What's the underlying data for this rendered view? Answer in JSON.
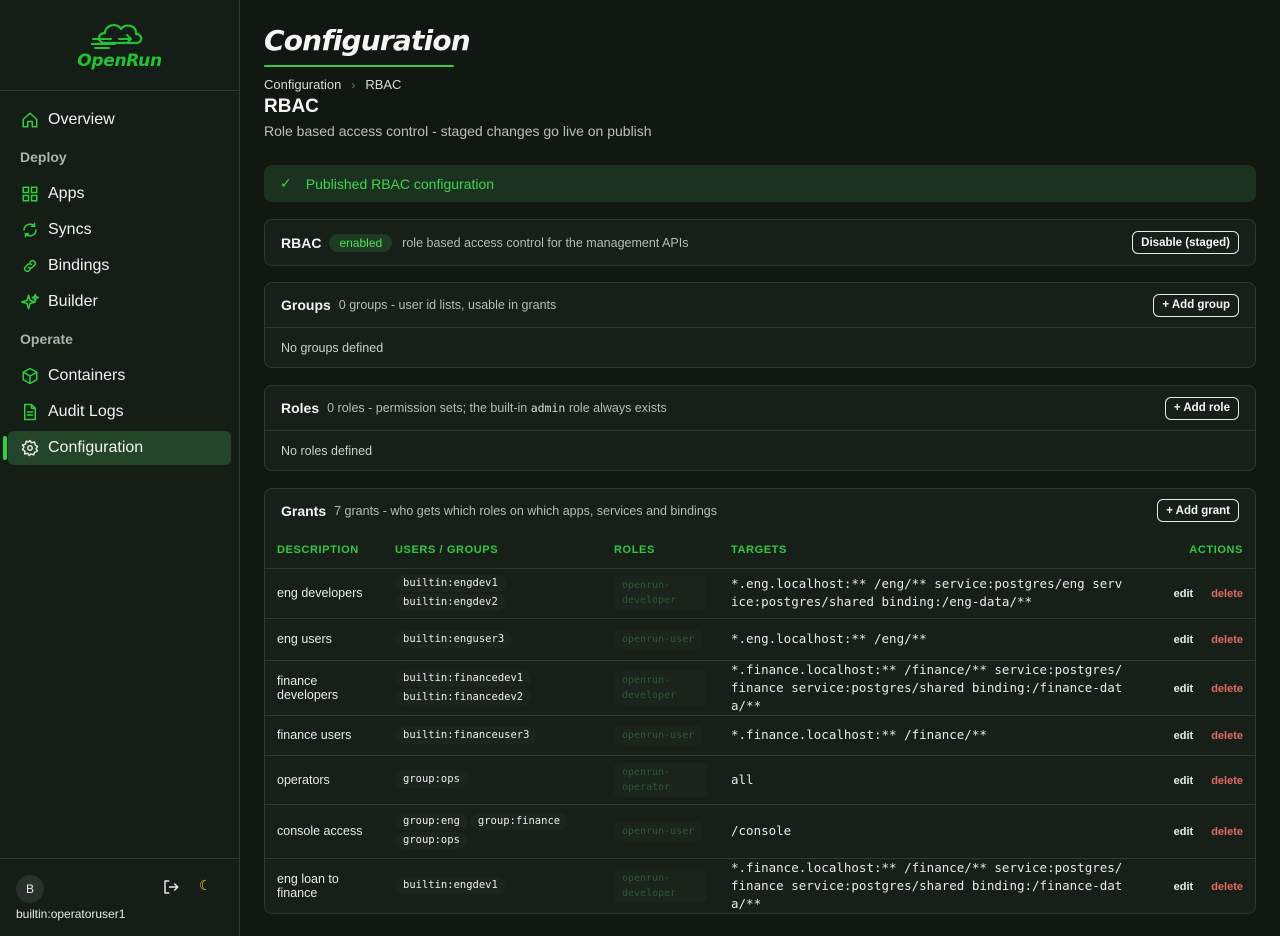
{
  "app": {
    "logo_text": "OpenRun"
  },
  "sidebar": {
    "items": [
      {
        "label": "Overview",
        "icon": "home-icon"
      },
      {
        "section": "Deploy"
      },
      {
        "label": "Apps",
        "icon": "grid-icon"
      },
      {
        "label": "Syncs",
        "icon": "refresh-icon"
      },
      {
        "label": "Bindings",
        "icon": "link-icon"
      },
      {
        "label": "Builder",
        "icon": "sparkles-icon"
      },
      {
        "section": "Operate"
      },
      {
        "label": "Containers",
        "icon": "box-icon"
      },
      {
        "label": "Audit Logs",
        "icon": "document-icon"
      },
      {
        "label": "Configuration",
        "icon": "gear-icon",
        "active": true
      }
    ],
    "footer": {
      "avatar_letter": "B",
      "user": "builtin:operatoruser1",
      "theme_icon": "☾"
    }
  },
  "page": {
    "title": "Configuration",
    "breadcrumb": [
      "Configuration",
      "RBAC"
    ],
    "subtitle": "RBAC",
    "description": "Role based access control - staged changes go live on publish"
  },
  "alert": {
    "icon": "✓",
    "text": "Published RBAC configuration"
  },
  "rbac_card": {
    "title": "RBAC",
    "badge": "enabled",
    "desc": "role based access control for the management APIs",
    "button": "Disable (staged)"
  },
  "groups_card": {
    "title": "Groups",
    "meta": "0 groups - user id lists, usable in grants",
    "button": "+ Add group",
    "empty": "No groups defined"
  },
  "roles_card": {
    "title": "Roles",
    "meta_before": "0 roles - permission sets; the built-in",
    "meta_code": "admin",
    "meta_after": "role always exists",
    "button": "+ Add role",
    "empty": "No roles defined"
  },
  "grants_card": {
    "title": "Grants",
    "meta": "7 grants - who gets which roles on which apps, services and bindings",
    "button": "+ Add grant",
    "columns": [
      "DESCRIPTION",
      "USERS / GROUPS",
      "ROLES",
      "TARGETS",
      "ACTIONS"
    ],
    "edit_label": "edit",
    "delete_label": "delete",
    "rows": [
      {
        "description": "eng developers",
        "users": [
          "builtin:engdev1",
          "builtin:engdev2"
        ],
        "role": "openrun-developer",
        "targets": "*.eng.localhost:** /eng/** service:postgres/eng service:postgres/shared binding:/eng-data/**"
      },
      {
        "description": "eng users",
        "users": [
          "builtin:enguser3"
        ],
        "role": "openrun-user",
        "targets": "*.eng.localhost:** /eng/**"
      },
      {
        "description": "finance developers",
        "users": [
          "builtin:financedev1",
          "builtin:financedev2"
        ],
        "role": "openrun-developer",
        "targets": "*.finance.localhost:** /finance/** service:postgres/finance service:postgres/shared binding:/finance-data/**"
      },
      {
        "description": "finance users",
        "users": [
          "builtin:financeuser3"
        ],
        "role": "openrun-user",
        "targets": "*.finance.localhost:** /finance/**"
      },
      {
        "description": "operators",
        "users": [
          "group:ops"
        ],
        "role": "openrun-operator",
        "targets": "all"
      },
      {
        "description": "console access",
        "users": [
          "group:eng",
          "group:finance",
          "group:ops"
        ],
        "role": "openrun-user",
        "targets": "/console"
      },
      {
        "description": "eng loan to finance",
        "users": [
          "builtin:engdev1"
        ],
        "role": "openrun-developer",
        "targets": "*.finance.localhost:** /finance/** service:postgres/finance service:postgres/shared binding:/finance-data/**"
      }
    ]
  }
}
